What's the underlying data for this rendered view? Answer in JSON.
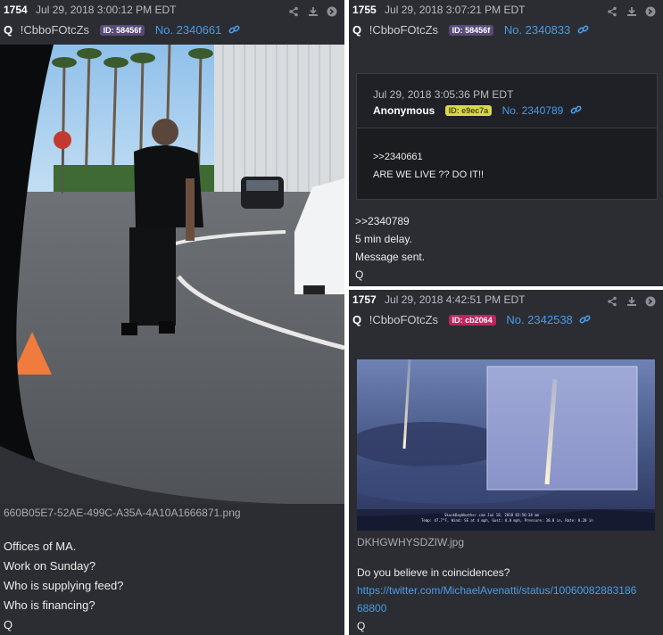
{
  "posts": {
    "p1754": {
      "number": "1754",
      "date": "Jul 29, 2018 3:00:12 PM EDT",
      "name": "Q",
      "tripcode": "!CbboFOtcZs",
      "id_badge": "ID: 58456f",
      "id_color": "#5a4a78",
      "post_no": "No. 2340661",
      "filename": "660B05E7-52AE-499C-A35A-4A10A1666871.png",
      "lines": [
        "Offices of MA.",
        "Work on Sunday?",
        "Who is supplying feed?",
        "Who is financing?",
        "Q"
      ]
    },
    "p1755": {
      "number": "1755",
      "date": "Jul 29, 2018 3:07:21 PM EDT",
      "name": "Q",
      "tripcode": "!CbboFOtcZs",
      "id_badge": "ID: 58456f",
      "id_color": "#5a4a78",
      "post_no": "No. 2340833",
      "quoted": {
        "date": "Jul 29, 2018 3:05:36 PM EDT",
        "name": "Anonymous",
        "id_badge": "ID: e9ec7a",
        "id_color": "#d9d84a",
        "post_no": "No. 2340789",
        "lines": [
          ">>2340661",
          "ARE WE LIVE ?? DO IT!!"
        ]
      },
      "lines": [
        ">>2340789",
        "5 min delay.",
        "Message sent.",
        "Q"
      ]
    },
    "p1757": {
      "number": "1757",
      "date": "Jul 29, 2018 4:42:51 PM EDT",
      "name": "Q",
      "tripcode": "!CbboFOtcZs",
      "id_badge": "ID: cb2064",
      "id_color": "#c0245e",
      "post_no": "No. 2342538",
      "filename": "DKHGWHYSDZIW.jpg",
      "image_caption": "SkunkBayWeather.com  Jun 18, 2018  03:56:34 am",
      "image_caption2": "Temp: 47.7°F, Wind: SE at 4 mph, Gust: 8.0 mph, Pressure: 30.0 in, Rate: 0.20 in",
      "line1": "Do you believe in coincidences?",
      "url": "https://twitter.com/MichaelAvenatti/status/1006008288318668800",
      "url_line1": "https://twitter.com/MichaelAvenatti/status/10060082883186",
      "url_line2": "68800",
      "sig": "Q"
    }
  },
  "icons": [
    "share-icon",
    "download-icon",
    "reply-arrow-icon",
    "link-icon"
  ]
}
